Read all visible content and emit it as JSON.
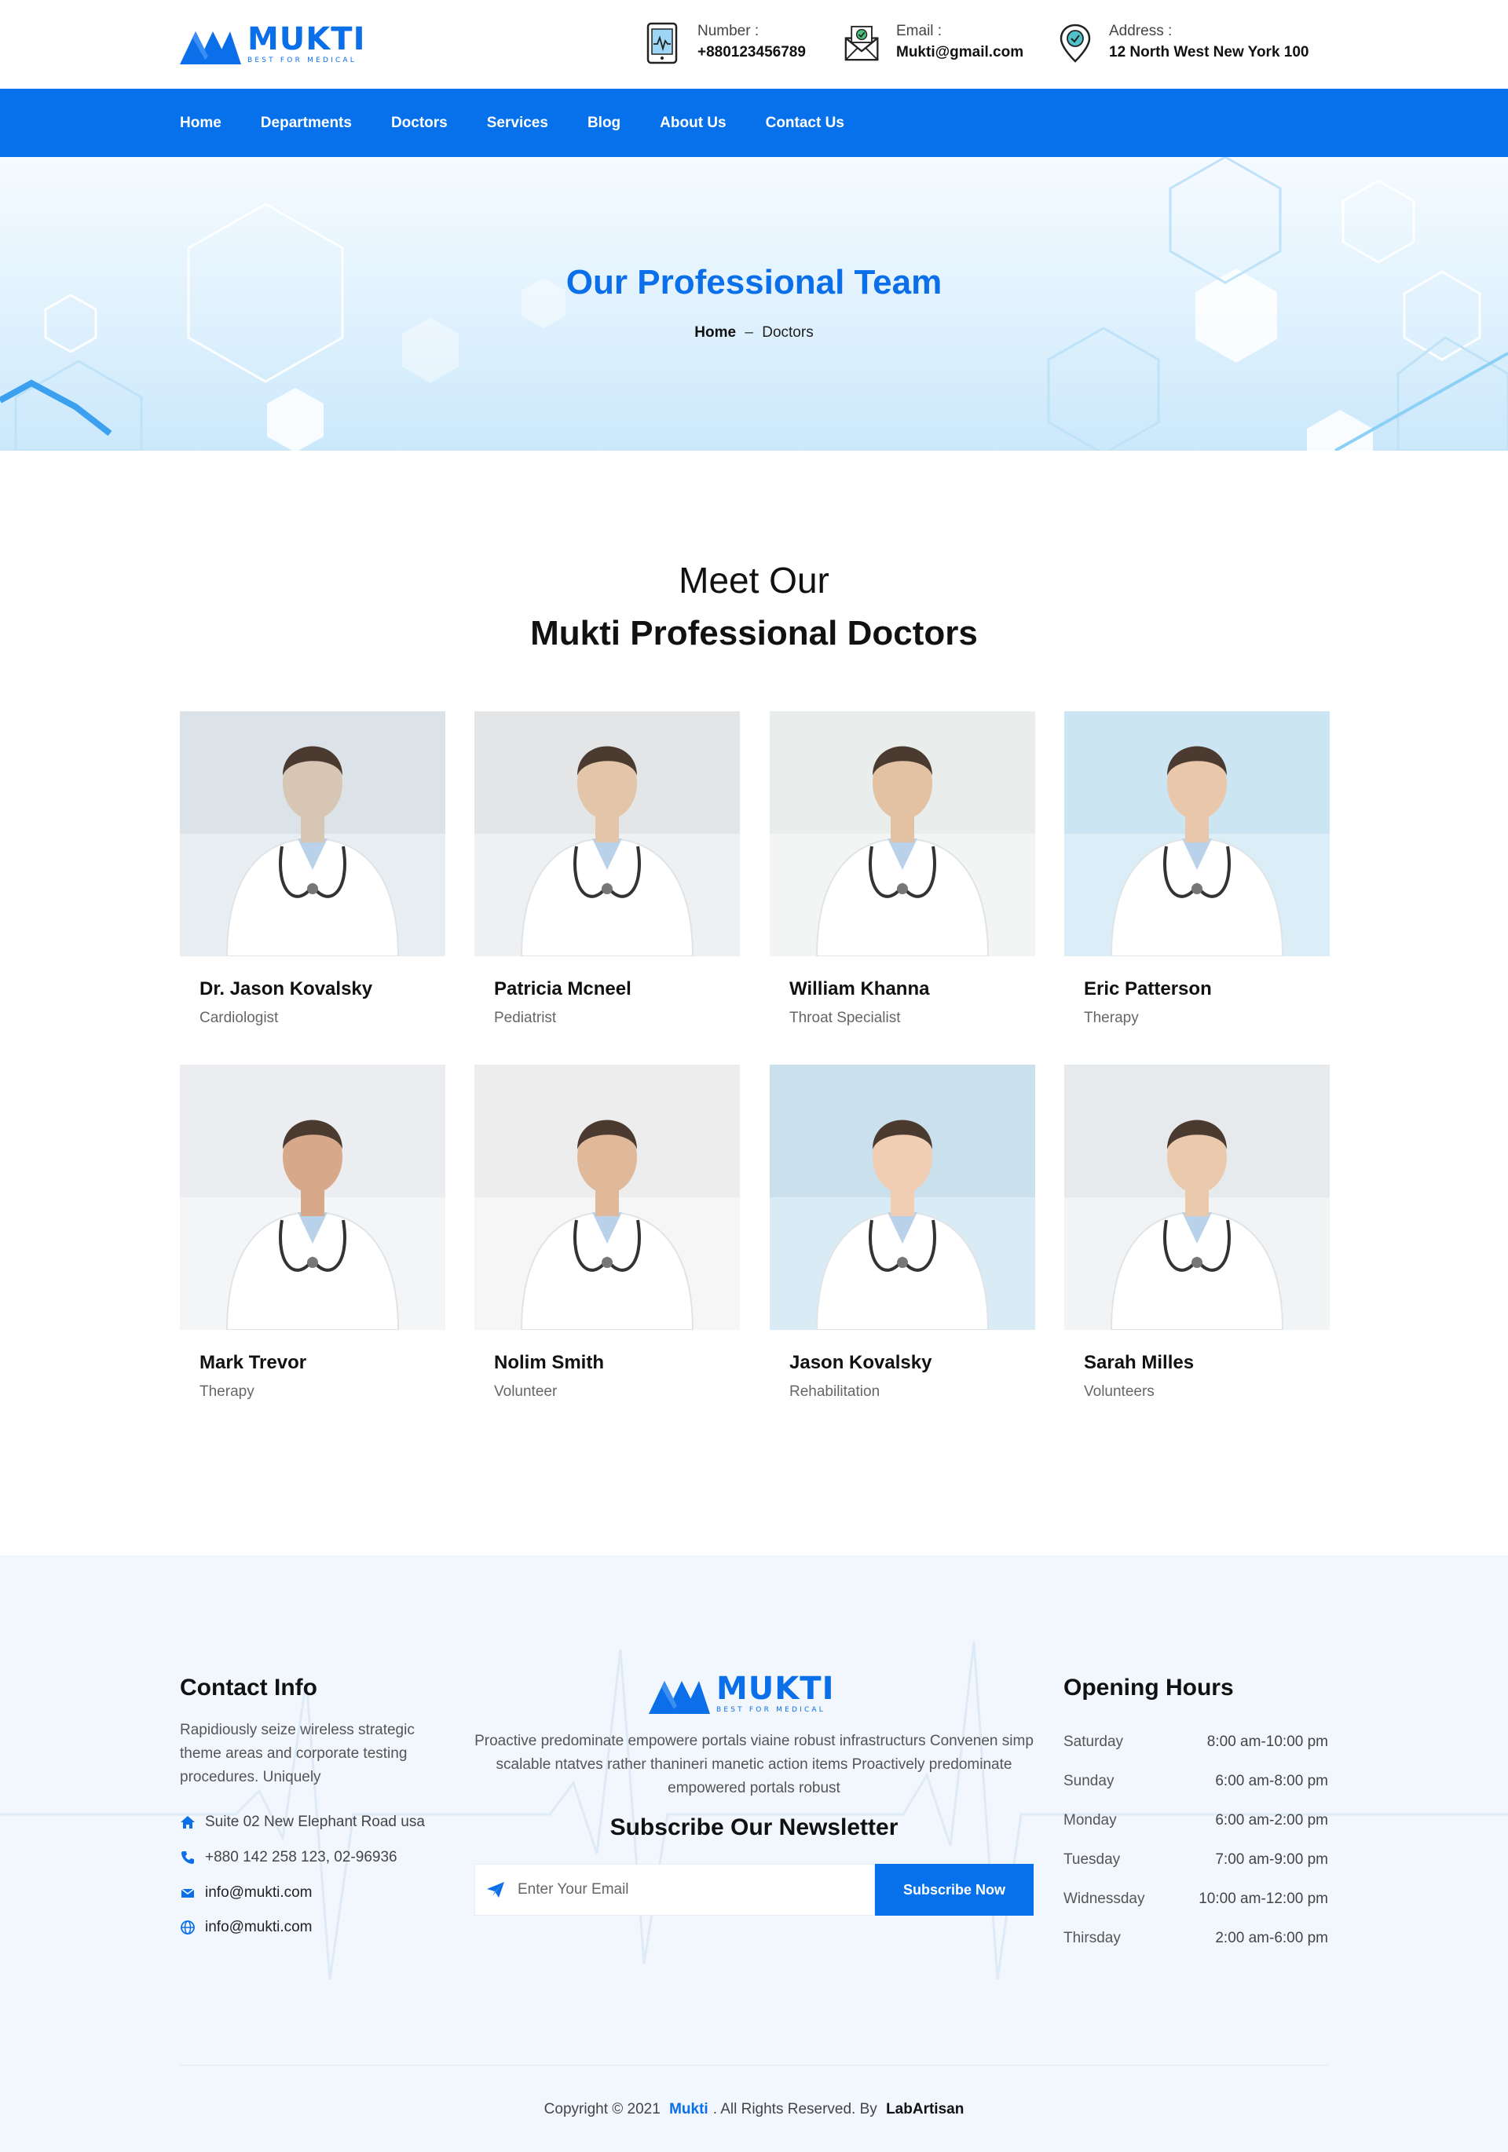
{
  "brand": {
    "name": "MUKTI",
    "tagline": "BEST FOR MEDICAL",
    "color": "#0a6fe8"
  },
  "header": {
    "contacts": [
      {
        "label": "Number :",
        "value": "+880123456789",
        "icon": "tablet-icon"
      },
      {
        "label": "Email :",
        "value": "Mukti@gmail.com",
        "icon": "envelope-icon"
      },
      {
        "label": "Address :",
        "value": "12 North West New York 100",
        "icon": "location-pin-icon"
      }
    ]
  },
  "nav": {
    "items": [
      "Home",
      "Departments",
      "Doctors",
      "Services",
      "Blog",
      "About Us",
      "Contact Us"
    ],
    "background": "#0671ea"
  },
  "hero": {
    "title": "Our Professional Team",
    "breadcrumb": {
      "home": "Home",
      "separator": "–",
      "current": "Doctors"
    }
  },
  "section": {
    "subtitle": "Meet Our",
    "title": "Mukti Professional Doctors"
  },
  "doctors": [
    {
      "name": "Dr. Jason Kovalsky",
      "role": "Cardiologist"
    },
    {
      "name": "Patricia Mcneel",
      "role": "Pediatrist"
    },
    {
      "name": "William Khanna",
      "role": "Throat Specialist"
    },
    {
      "name": "Eric Patterson",
      "role": "Therapy"
    },
    {
      "name": "Mark Trevor",
      "role": "Therapy"
    },
    {
      "name": "Nolim Smith",
      "role": "Volunteer"
    },
    {
      "name": "Jason Kovalsky",
      "role": "Rehabilitation"
    },
    {
      "name": "Sarah Milles",
      "role": "Volunteers"
    }
  ],
  "footer": {
    "contact": {
      "title": "Contact Info",
      "description": "Rapidiously seize wireless strategic theme areas and corporate testing procedures. Uniquely",
      "address": "Suite 02 New Elephant Road usa",
      "phone": "+880 142 258 123, 02-96936",
      "email": "info@mukti.com",
      "website": "info@mukti.com"
    },
    "about": {
      "text": "Proactive predominate empowere portals viaine robust infrastructurs Convenen simp scalable ntatves rather thanineri manetic action items Proactively predominate empowered portals robust"
    },
    "newsletter": {
      "title": "Subscribe Our Newsletter",
      "placeholder": "Enter Your Email",
      "button": "Subscribe Now"
    },
    "hours": {
      "title": "Opening Hours",
      "rows": [
        {
          "day": "Saturday",
          "time": "8:00 am-10:00 pm"
        },
        {
          "day": "Sunday",
          "time": "6:00 am-8:00 pm"
        },
        {
          "day": "Monday",
          "time": "6:00 am-2:00 pm"
        },
        {
          "day": "Tuesday",
          "time": "7:00 am-9:00 pm"
        },
        {
          "day": "Widnessday",
          "time": "10:00 am-12:00 pm"
        },
        {
          "day": "Thirsday",
          "time": "2:00 am-6:00 pm"
        }
      ]
    },
    "copyright": {
      "prefix": "Copyright © 2021",
      "brand": "Mukti",
      "middle": ". All Rights Reserved. By",
      "author": "LabArtisan"
    }
  }
}
